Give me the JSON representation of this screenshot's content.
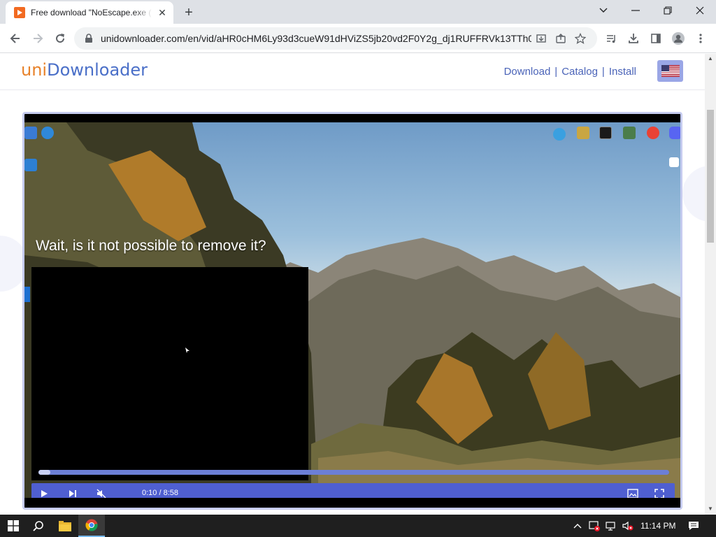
{
  "browser": {
    "tab_title": "Free download \"NoEscape.exe (",
    "url": "unidownloader.com/en/vid/aHR0cHM6Ly93d3cueW91dHViZS5jb20vd2F0Y2g_dj1RUFFRVk13TTh0Vj..."
  },
  "site": {
    "logo_part1": "uni",
    "logo_part2": "Downloader",
    "nav": [
      {
        "label": "Download"
      },
      {
        "label": "Catalog"
      },
      {
        "label": "Install"
      }
    ],
    "separator": "|",
    "language_flag": "us-flag-icon"
  },
  "video": {
    "caption": "Wait, is it not possible to remove it?",
    "time_display": "0:10 / 8:58",
    "progress_fraction": 0.019
  },
  "taskbar": {
    "clock": "11:14 PM"
  }
}
